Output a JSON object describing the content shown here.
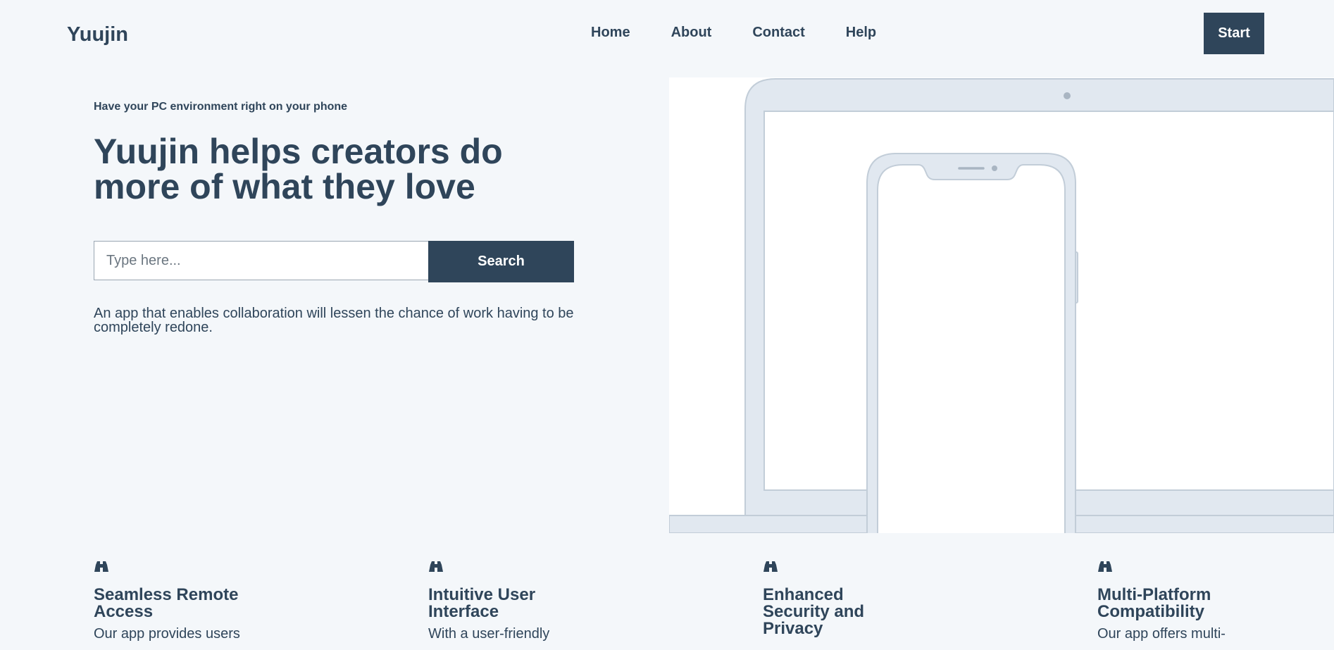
{
  "header": {
    "logo": "Yuujin",
    "nav": [
      {
        "label": "Home"
      },
      {
        "label": "About"
      },
      {
        "label": "Contact"
      },
      {
        "label": "Help"
      }
    ],
    "start_label": "Start"
  },
  "hero": {
    "eyebrow": "Have your PC environment right on your phone",
    "headline": "Yuujin helps creators do more of what they love",
    "search": {
      "placeholder": "Type here...",
      "value": "",
      "button_label": "Search"
    },
    "description": "An app that enables collaboration will lessen the chance of work having to be completely redone.",
    "illustration_icon": "laptop-and-phone-illustration"
  },
  "features": [
    {
      "icon": "binoculars-icon",
      "title": "Seamless Remote Access",
      "text": "Our app provides users"
    },
    {
      "icon": "binoculars-icon",
      "title": "Intuitive User Interface",
      "text": "With a user-friendly"
    },
    {
      "icon": "binoculars-icon",
      "title": "Enhanced Security and Privacy",
      "text": ""
    },
    {
      "icon": "binoculars-icon",
      "title": "Multi-Platform Compatibility",
      "text": "Our app offers multi-"
    }
  ],
  "colors": {
    "primary": "#2f455a",
    "background": "#f4f7fa",
    "illustration_fill": "#e1e8f0",
    "illustration_stroke": "#c2cdd8"
  }
}
